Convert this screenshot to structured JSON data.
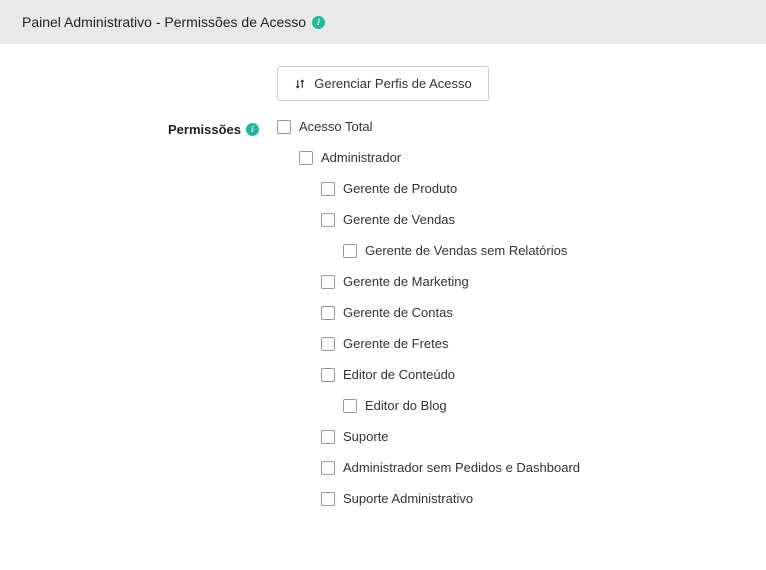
{
  "header": {
    "title": "Painel Administrativo - Permissões de Acesso"
  },
  "toolbar": {
    "manage_profiles_label": "Gerenciar Perfis de Acesso"
  },
  "section": {
    "label": "Permissões"
  },
  "permissions": [
    {
      "label": "Acesso Total",
      "indent": 0
    },
    {
      "label": "Administrador",
      "indent": 1
    },
    {
      "label": "Gerente de Produto",
      "indent": 2
    },
    {
      "label": "Gerente de Vendas",
      "indent": 2
    },
    {
      "label": "Gerente de Vendas sem Relatórios",
      "indent": 3
    },
    {
      "label": "Gerente de Marketing",
      "indent": 2
    },
    {
      "label": "Gerente de Contas",
      "indent": 2
    },
    {
      "label": "Gerente de Fretes",
      "indent": 2
    },
    {
      "label": "Editor de Conteúdo",
      "indent": 2
    },
    {
      "label": "Editor do Blog",
      "indent": 3
    },
    {
      "label": "Suporte",
      "indent": 2
    },
    {
      "label": "Administrador sem Pedidos e Dashboard",
      "indent": 2
    },
    {
      "label": "Suporte Administrativo",
      "indent": 2
    }
  ]
}
